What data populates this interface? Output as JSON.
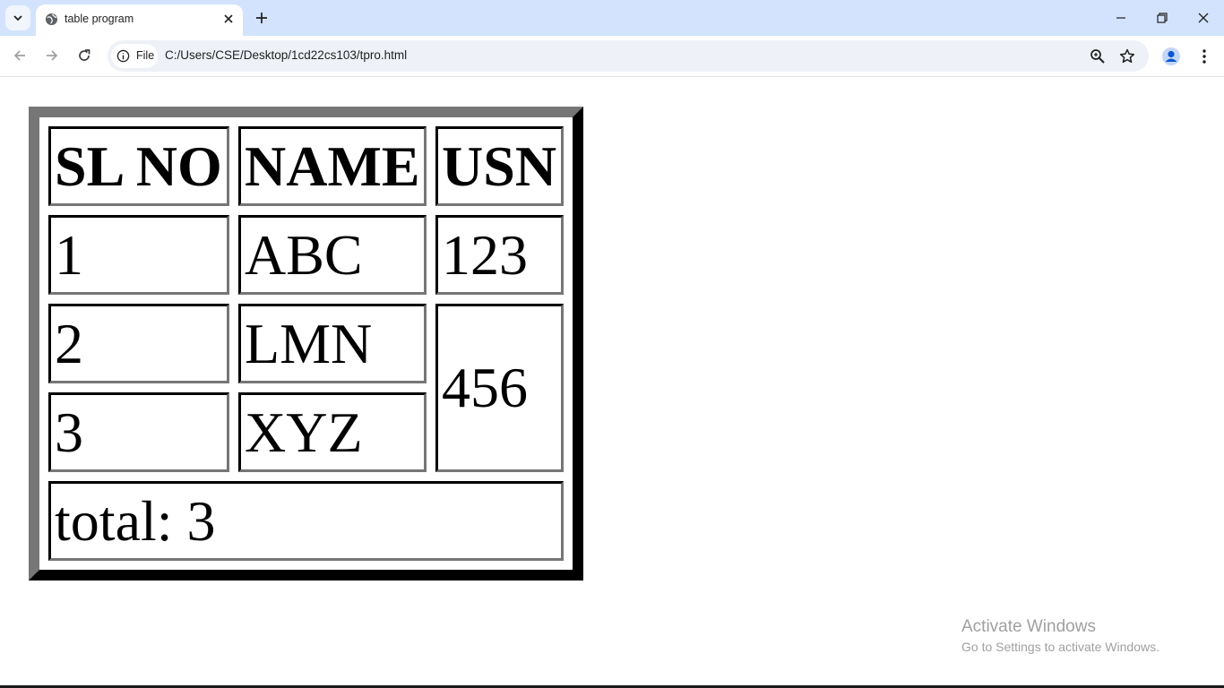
{
  "browser": {
    "tab": {
      "title": "table program",
      "favicon": "globe-icon"
    },
    "address": {
      "chip_label": "File",
      "url": "C:/Users/CSE/Desktop/1cd22cs103/tpro.html"
    }
  },
  "table": {
    "headers": [
      "SL NO",
      "NAME",
      "USN"
    ],
    "rows": [
      {
        "sl": "1",
        "name": "ABC",
        "usn": "123"
      },
      {
        "sl": "2",
        "name": "LMN",
        "usn": "456"
      },
      {
        "sl": "3",
        "name": "XYZ"
      }
    ],
    "footer": "total: 3"
  },
  "watermark": {
    "title": "Activate Windows",
    "subtitle": "Go to Settings to activate Windows."
  }
}
